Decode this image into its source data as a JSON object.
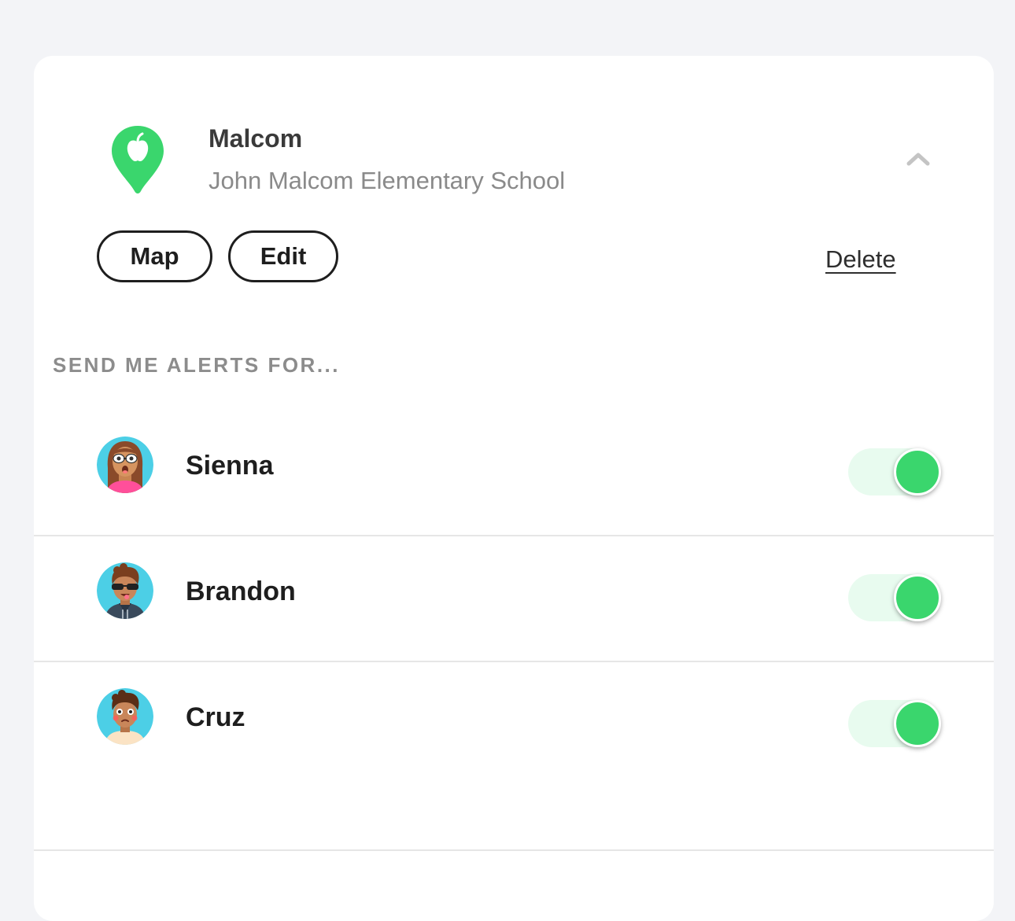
{
  "place": {
    "name": "Malcom",
    "address": "John Malcom Elementary School",
    "pin_color": "#3ad66d",
    "icon": "apple-location-pin-icon"
  },
  "actions": {
    "map_label": "Map",
    "edit_label": "Edit",
    "delete_label": "Delete",
    "collapse_icon": "chevron-up-icon"
  },
  "alerts": {
    "section_label": "SEND ME ALERTS FOR...",
    "members": [
      {
        "name": "Sienna",
        "enabled": true,
        "avatar": "avatar-sienna"
      },
      {
        "name": "Brandon",
        "enabled": true,
        "avatar": "avatar-brandon"
      },
      {
        "name": "Cruz",
        "enabled": true,
        "avatar": "avatar-cruz"
      }
    ],
    "toggle_on_color": "#3ad66d",
    "toggle_track_color": "#e8fbef"
  }
}
